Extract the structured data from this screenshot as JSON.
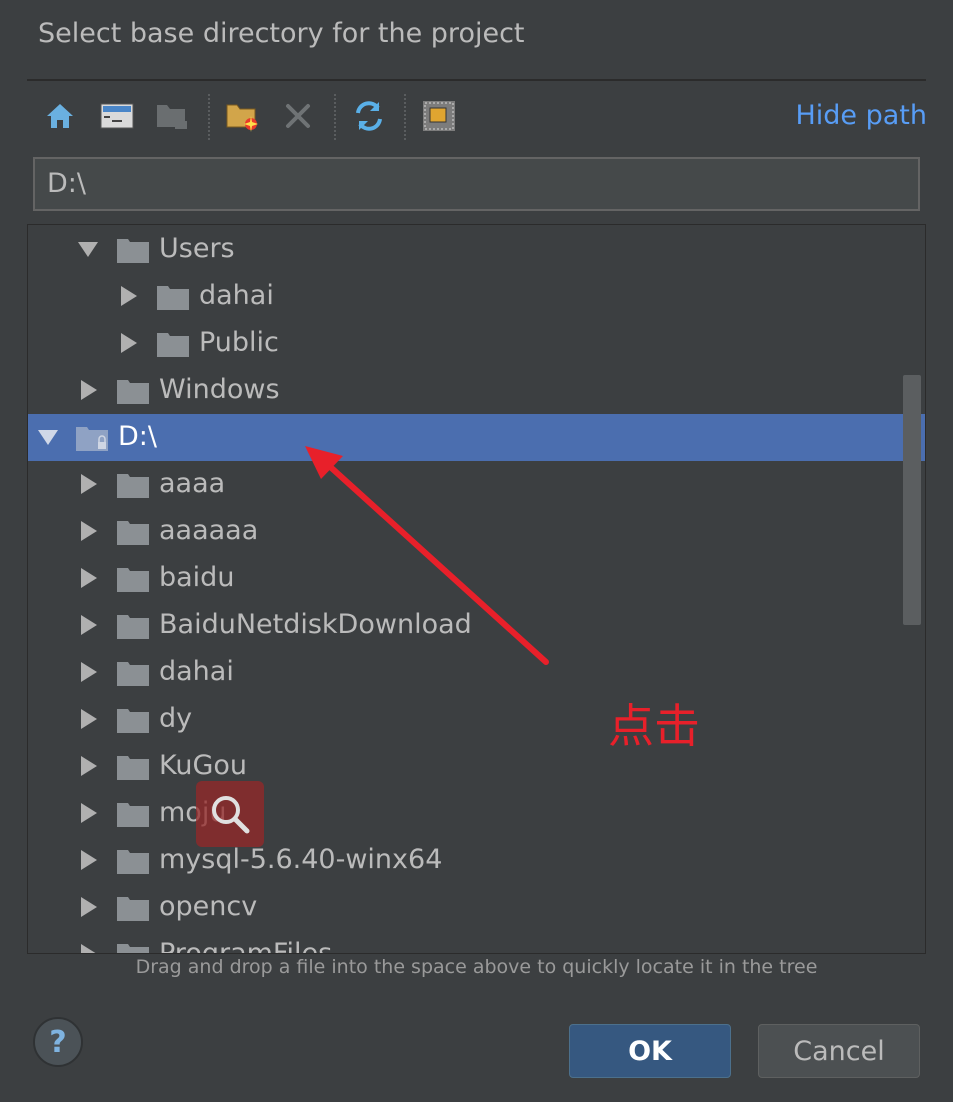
{
  "dialog": {
    "title": "Select base directory for the project"
  },
  "toolbar": {
    "buttons": [
      {
        "name": "home-icon"
      },
      {
        "name": "desktop-icon"
      },
      {
        "name": "project-folder-icon"
      },
      {
        "name": "new-folder-icon"
      },
      {
        "name": "delete-icon"
      },
      {
        "name": "refresh-icon"
      },
      {
        "name": "show-hidden-icon"
      }
    ],
    "hide_path_label": "Hide path"
  },
  "path": {
    "value": "D:\\"
  },
  "tree": {
    "rows": [
      {
        "label": "Users",
        "expanded": true
      },
      {
        "label": "dahai",
        "expanded": false
      },
      {
        "label": "Public",
        "expanded": false
      },
      {
        "label": "Windows",
        "expanded": false
      },
      {
        "label": "D:\\",
        "expanded": true,
        "selected": true
      },
      {
        "label": "aaaa",
        "expanded": false
      },
      {
        "label": "aaaaaa",
        "expanded": false
      },
      {
        "label": "baidu",
        "expanded": false
      },
      {
        "label": "BaiduNetdiskDownload",
        "expanded": false
      },
      {
        "label": "dahai",
        "expanded": false
      },
      {
        "label": "dy",
        "expanded": false
      },
      {
        "label": "KuGou",
        "expanded": false
      },
      {
        "label": "moju",
        "expanded": false
      },
      {
        "label": "mysql-5.6.40-winx64",
        "expanded": false
      },
      {
        "label": "opencv",
        "expanded": false
      },
      {
        "label": "ProgramFiles",
        "expanded": false
      }
    ]
  },
  "hint": "Drag and drop a file into the space above to quickly locate it in the tree",
  "footer": {
    "help_label": "?",
    "ok_label": "OK",
    "cancel_label": "Cancel"
  },
  "annotation": {
    "text": "点击",
    "color": "#e8202a"
  },
  "colors": {
    "background": "#3c3f41",
    "selection": "#4b6eaf",
    "link": "#589df6",
    "ok_button": "#365880"
  }
}
